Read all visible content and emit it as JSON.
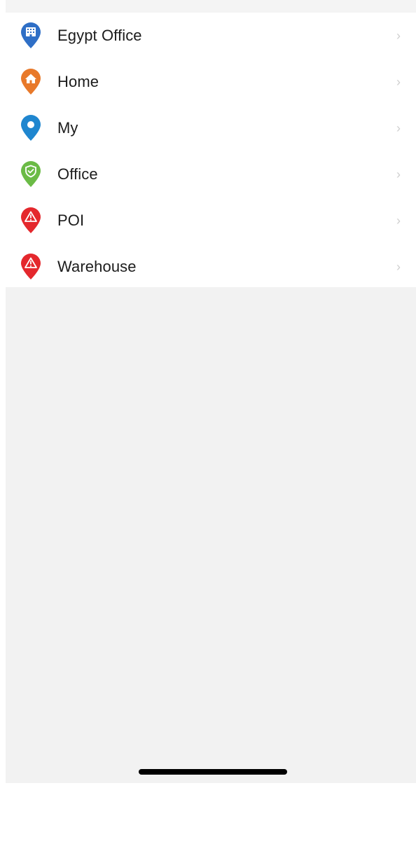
{
  "locations": [
    {
      "label": "Egypt Office",
      "icon": "building-pin-icon",
      "color": "#2f6fc6"
    },
    {
      "label": "Home",
      "icon": "house-pin-icon",
      "color": "#e8792a"
    },
    {
      "label": "My",
      "icon": "location-pin-icon",
      "color": "#1f86cf"
    },
    {
      "label": "Office",
      "icon": "shield-pin-icon",
      "color": "#6bbb46"
    },
    {
      "label": "POI",
      "icon": "warning-pin-icon",
      "color": "#e4282d"
    },
    {
      "label": "Warehouse",
      "icon": "warning-pin-icon",
      "color": "#e4282d"
    }
  ],
  "chevron": "›"
}
